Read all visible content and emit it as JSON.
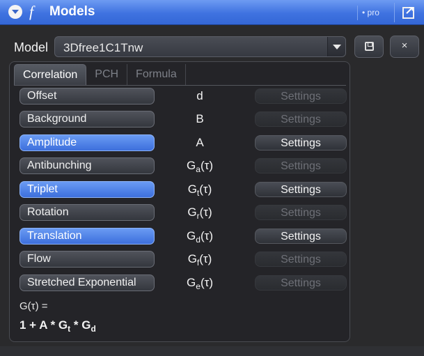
{
  "titlebar": {
    "func_glyph": "f",
    "title": "Models",
    "pro_label": "• pro",
    "toggle_icon": "collapse-arrow-icon",
    "expand_icon": "expand-window-icon"
  },
  "model": {
    "label": "Model",
    "value": "3Dfree1C1Tnw",
    "save_icon": "save-icon",
    "close_label": "×"
  },
  "tabs": [
    {
      "label": "Correlation",
      "active": true
    },
    {
      "label": "PCH",
      "active": false
    },
    {
      "label": "Formula",
      "active": false
    }
  ],
  "params": [
    {
      "label": "Offset",
      "enabled": false,
      "symbol_main": "d",
      "symbol_sub": "",
      "symbol_tail": "",
      "settings": "Settings"
    },
    {
      "label": "Background",
      "enabled": false,
      "symbol_main": "B",
      "symbol_sub": "",
      "symbol_tail": "",
      "settings": "Settings"
    },
    {
      "label": "Amplitude",
      "enabled": true,
      "symbol_main": "A",
      "symbol_sub": "",
      "symbol_tail": "",
      "settings": "Settings"
    },
    {
      "label": "Antibunching",
      "enabled": false,
      "symbol_main": "G",
      "symbol_sub": "a",
      "symbol_tail": "(τ)",
      "settings": "Settings"
    },
    {
      "label": "Triplet",
      "enabled": true,
      "symbol_main": "G",
      "symbol_sub": "t",
      "symbol_tail": "(τ)",
      "settings": "Settings"
    },
    {
      "label": "Rotation",
      "enabled": false,
      "symbol_main": "G",
      "symbol_sub": "r",
      "symbol_tail": "(τ)",
      "settings": "Settings"
    },
    {
      "label": "Translation",
      "enabled": true,
      "symbol_main": "G",
      "symbol_sub": "d",
      "symbol_tail": "(τ)",
      "settings": "Settings"
    },
    {
      "label": "Flow",
      "enabled": false,
      "symbol_main": "G",
      "symbol_sub": "f",
      "symbol_tail": "(τ)",
      "settings": "Settings"
    },
    {
      "label": "Stretched Exponential",
      "enabled": false,
      "symbol_main": "G",
      "symbol_sub": "e",
      "symbol_tail": "(τ)",
      "settings": "Settings"
    }
  ],
  "formula": {
    "head": "G(τ) =",
    "part1": "1 + A * G",
    "sub1": "t",
    "part2": " * G",
    "sub2": "d"
  },
  "colors": {
    "titlebar": "#3f72e0",
    "active_param": "#4d80e6",
    "panel_bg": "#242428",
    "window_bg": "#2a2a2c"
  }
}
